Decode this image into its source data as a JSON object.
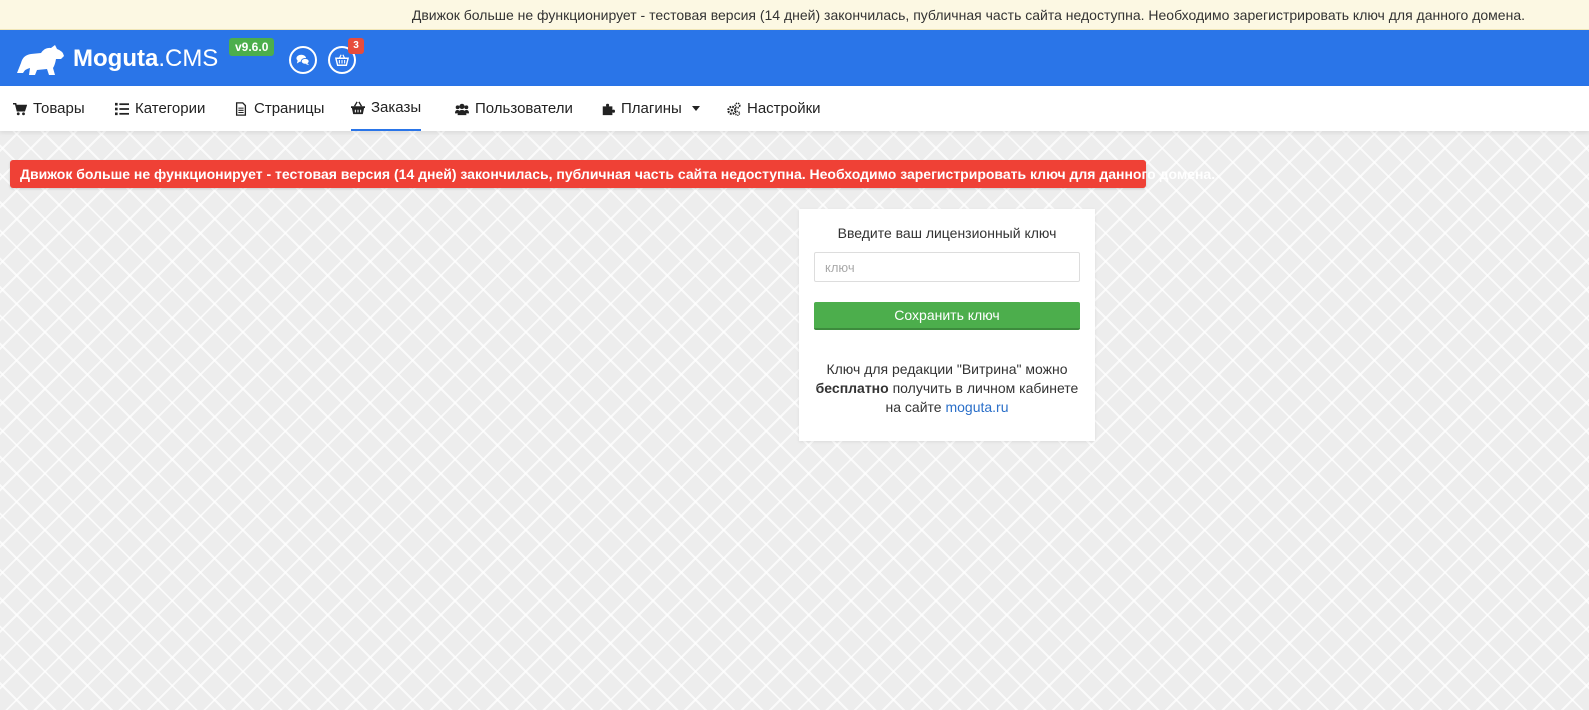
{
  "topbar": {
    "message": "Движок больше не функционирует - тестовая версия (14 дней) закончилась, публичная часть сайта недоступна. Необходимо зарегистрировать ключ для данного домена."
  },
  "header": {
    "logo_bold": "Moguta",
    "logo_light": ".CMS",
    "version": "v9.6.0",
    "cart_count": "3",
    "colors": {
      "header_bg": "#2a75e8",
      "version_bg": "#4cae4c",
      "badge_bg": "#e74c3c"
    }
  },
  "nav": {
    "items": [
      {
        "label": "Товары",
        "icon": "cart-icon"
      },
      {
        "label": "Категории",
        "icon": "list-icon"
      },
      {
        "label": "Страницы",
        "icon": "document-icon"
      },
      {
        "label": "Заказы",
        "icon": "basket-icon",
        "active": true
      },
      {
        "label": "Пользователи",
        "icon": "users-icon"
      },
      {
        "label": "Плагины",
        "icon": "puzzle-icon",
        "dropdown": true
      },
      {
        "label": "Настройки",
        "icon": "gears-icon"
      }
    ]
  },
  "alert": {
    "message": "Движок больше не функционирует - тестовая версия (14 дней) закончилась, публичная часть сайта недоступна. Необходимо зарегистрировать ключ для данного домена.",
    "color": "#ef4136"
  },
  "license": {
    "title": "Введите ваш лицензионный ключ",
    "input_value": "",
    "input_placeholder": "ключ",
    "save_label": "Сохранить ключ",
    "note_part1": "Ключ для редакции \"Витрина\" можно",
    "note_bold": "бесплатно",
    "note_part2": "получить в личном кабинете на сайте",
    "note_link": "moguta.ru"
  }
}
